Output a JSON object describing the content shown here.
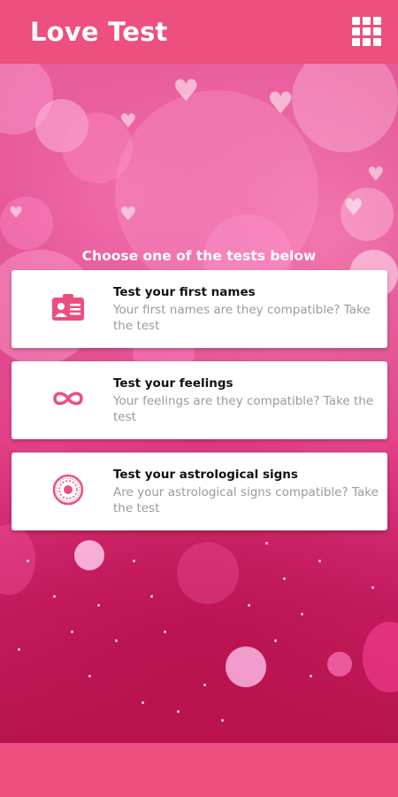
{
  "app_bar": {
    "title": "Love Test",
    "menu_icon": "grid-menu-icon"
  },
  "prompt": "Choose one of the tests below",
  "tests": [
    {
      "title": "Test your first names",
      "description": "Your first names are they compatible? Take the test",
      "icon": "id-card-icon"
    },
    {
      "title": "Test your feelings",
      "description": "Your feelings are they compatible? Take the test",
      "icon": "infinity-icon"
    },
    {
      "title": "Test your astrological signs",
      "description": "Are your astrological signs compatible? Take the test",
      "icon": "zodiac-wheel-icon"
    }
  ],
  "colors": {
    "primary": "#ed4f7f",
    "card_bg": "#ffffff",
    "title_text": "#111111",
    "desc_text": "#9a9a9a"
  }
}
